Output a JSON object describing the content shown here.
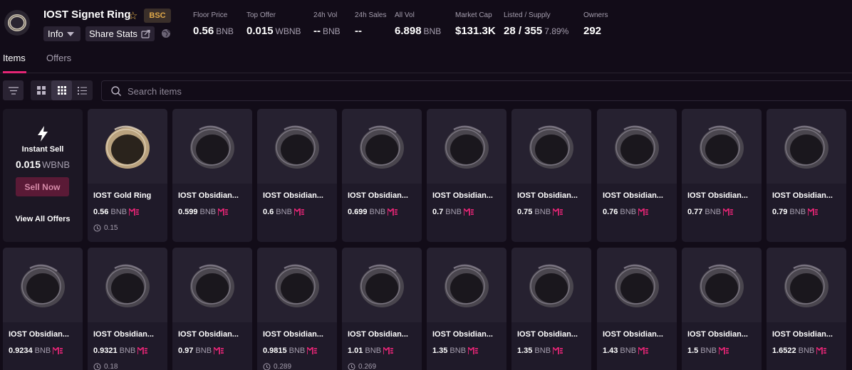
{
  "collection": {
    "name": "IOST Signet Ring",
    "chain_badge": "BSC",
    "info_label": "Info",
    "share_label": "Share Stats"
  },
  "stats": [
    {
      "label": "Floor Price",
      "value": "0.56",
      "unit": "BNB"
    },
    {
      "label": "Top Offer",
      "value": "0.015",
      "unit": "WBNB"
    },
    {
      "label": "24h Vol",
      "value": "--",
      "unit": "BNB"
    },
    {
      "label": "24h Sales",
      "value": "--",
      "unit": ""
    },
    {
      "label": "All Vol",
      "value": "6.898",
      "unit": "BNB"
    },
    {
      "label": "Market Cap",
      "value": "$131.3K",
      "unit": ""
    },
    {
      "label": "Listed / Supply",
      "value": "28 / 355",
      "unit": "7.89%"
    },
    {
      "label": "Owners",
      "value": "292",
      "unit": ""
    }
  ],
  "tabs": [
    {
      "label": "Items",
      "active": true
    },
    {
      "label": "Offers",
      "active": false
    }
  ],
  "search": {
    "placeholder": "Search items"
  },
  "instant_sell": {
    "title": "Instant Sell",
    "value": "0.015",
    "unit": "WBNB",
    "button": "Sell Now",
    "link": "View All Offers"
  },
  "items": [
    {
      "name": "IOST Gold Ring",
      "price": "0.56",
      "unit": "BNB",
      "last_sale": "0.15",
      "variant": "gold"
    },
    {
      "name": "IOST Obsidian...",
      "price": "0.599",
      "unit": "BNB",
      "last_sale": "",
      "variant": "obsidian"
    },
    {
      "name": "IOST Obsidian...",
      "price": "0.6",
      "unit": "BNB",
      "last_sale": "",
      "variant": "obsidian"
    },
    {
      "name": "IOST Obsidian...",
      "price": "0.699",
      "unit": "BNB",
      "last_sale": "",
      "variant": "obsidian"
    },
    {
      "name": "IOST Obsidian...",
      "price": "0.7",
      "unit": "BNB",
      "last_sale": "",
      "variant": "obsidian"
    },
    {
      "name": "IOST Obsidian...",
      "price": "0.75",
      "unit": "BNB",
      "last_sale": "",
      "variant": "obsidian"
    },
    {
      "name": "IOST Obsidian...",
      "price": "0.76",
      "unit": "BNB",
      "last_sale": "",
      "variant": "obsidian"
    },
    {
      "name": "IOST Obsidian...",
      "price": "0.77",
      "unit": "BNB",
      "last_sale": "",
      "variant": "obsidian"
    },
    {
      "name": "IOST Obsidian...",
      "price": "0.79",
      "unit": "BNB",
      "last_sale": "",
      "variant": "obsidian"
    },
    {
      "name": "IOST Obsidian...",
      "price": "0.9234",
      "unit": "BNB",
      "last_sale": "",
      "variant": "obsidian"
    },
    {
      "name": "IOST Obsidian...",
      "price": "0.9321",
      "unit": "BNB",
      "last_sale": "0.18",
      "variant": "obsidian"
    },
    {
      "name": "IOST Obsidian...",
      "price": "0.97",
      "unit": "BNB",
      "last_sale": "",
      "variant": "obsidian"
    },
    {
      "name": "IOST Obsidian...",
      "price": "0.9815",
      "unit": "BNB",
      "last_sale": "0.289",
      "variant": "obsidian"
    },
    {
      "name": "IOST Obsidian...",
      "price": "1.01",
      "unit": "BNB",
      "last_sale": "0.269",
      "variant": "obsidian"
    },
    {
      "name": "IOST Obsidian...",
      "price": "1.35",
      "unit": "BNB",
      "last_sale": "",
      "variant": "obsidian"
    },
    {
      "name": "IOST Obsidian...",
      "price": "1.35",
      "unit": "BNB",
      "last_sale": "",
      "variant": "obsidian"
    },
    {
      "name": "IOST Obsidian...",
      "price": "1.43",
      "unit": "BNB",
      "last_sale": "",
      "variant": "obsidian"
    },
    {
      "name": "IOST Obsidian...",
      "price": "1.5",
      "unit": "BNB",
      "last_sale": "",
      "variant": "obsidian"
    },
    {
      "name": "IOST Obsidian...",
      "price": "1.6522",
      "unit": "BNB",
      "last_sale": "",
      "variant": "obsidian"
    }
  ],
  "icons": {
    "logo": "ring-logo-icon",
    "star": "star-icon",
    "info_dropdown": "chevron-down-icon",
    "share": "external-link-icon",
    "globe": "globe-icon",
    "filter": "filter-icon",
    "grid_large": "grid-large-icon",
    "grid_small": "grid-small-icon",
    "list": "list-icon",
    "search": "search-icon",
    "bolt": "bolt-icon",
    "marketplace": "me-logo-icon",
    "last_sale": "last-sale-icon"
  },
  "colors": {
    "background": "#120c18",
    "card": "#1f1a29",
    "accent": "#e42575",
    "muted_text": "#a59eae",
    "star": "#e8b54a"
  }
}
